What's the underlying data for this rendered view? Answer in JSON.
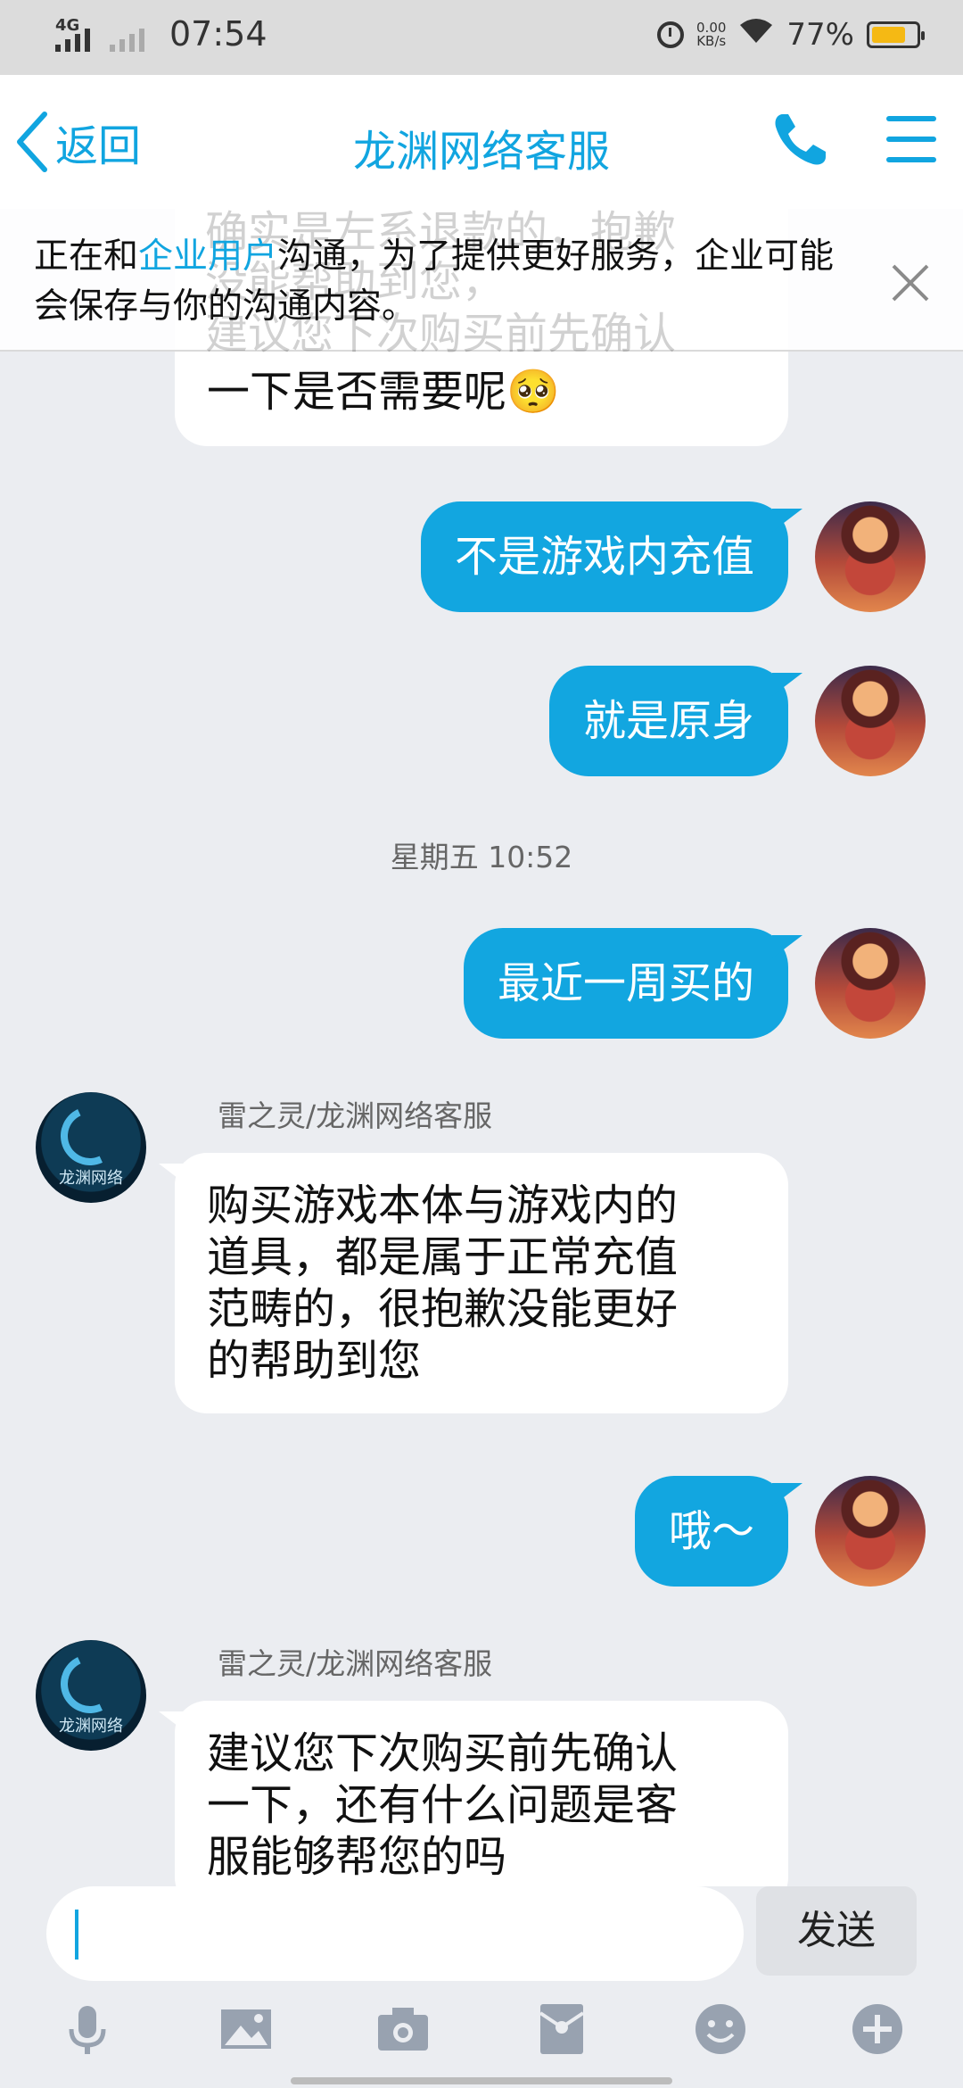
{
  "status_bar": {
    "network": "4G",
    "time": "07:54",
    "speed_value": "0.00",
    "speed_unit": "KB/s",
    "battery_pct": "77%",
    "battery_level": 0.77,
    "battery_color": "#f5b914"
  },
  "header": {
    "back_label": "返回",
    "title": "龙渊网络客服",
    "accent_color": "#11a5e0"
  },
  "notice": {
    "text_before": "正在和",
    "highlight": "企业用户",
    "text_after": "沟通，为了提供更好服务，企业可能会保存与你的沟通内容。",
    "ghost_line1": "确实是左系退款的，抱歉",
    "ghost_line2": "没能帮助到您，",
    "ghost_line3": "建议您下次购买前先确认"
  },
  "messages": {
    "m0_tail": "一下是否需要呢🥺",
    "m1": "不是游戏内充值",
    "m2": "就是原身",
    "timestamp": "星期五 10:52",
    "m3": "最近一周买的",
    "sender1": "雷之灵/龙渊网络客服",
    "m4_line1": "购买游戏本体与游戏内的",
    "m4_line2": "道具，都是属于正常充值",
    "m4_line3": "范畴的，很抱歉没能更好",
    "m4_line4": "的帮助到您",
    "m5": "哦～",
    "sender2": "雷之灵/龙渊网络客服",
    "m6_line1": "建议您下次购买前先确认",
    "m6_line2": "一下，还有什么问题是客",
    "m6_line3": "服能够帮您的吗",
    "cs_avatar_text": "龙渊网络"
  },
  "input": {
    "value": "",
    "send_label": "发送"
  },
  "toolbar": {
    "icons": [
      "microphone-icon",
      "image-icon",
      "camera-icon",
      "red-packet-icon",
      "emoji-icon",
      "plus-icon"
    ]
  }
}
